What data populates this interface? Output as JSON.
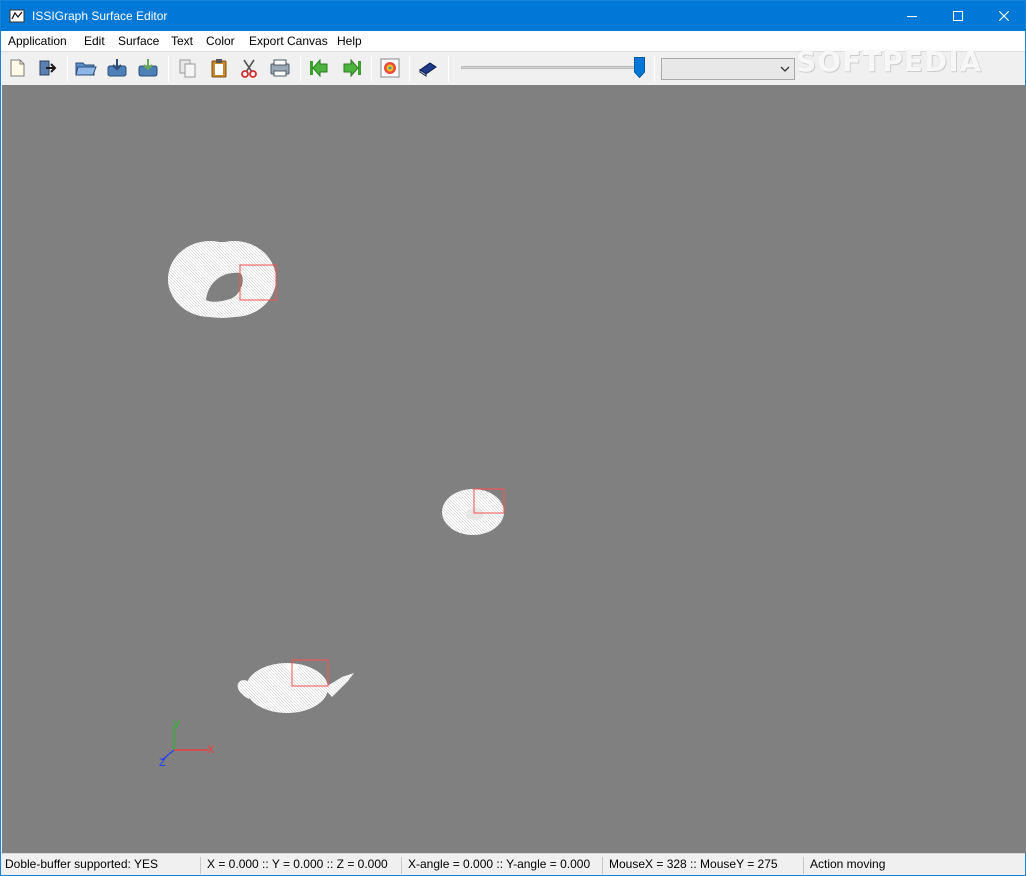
{
  "window": {
    "title": "ISSIGraph Surface Editor",
    "accent_color": "#0078d7"
  },
  "menu": [
    {
      "label": "Application"
    },
    {
      "label": "Edit"
    },
    {
      "label": "Surface"
    },
    {
      "label": "Text"
    },
    {
      "label": "Color"
    },
    {
      "label": "Export Canvas"
    },
    {
      "label": "Help"
    }
  ],
  "toolbar": {
    "buttons": [
      {
        "icon": "new-document-icon"
      },
      {
        "icon": "exit-icon"
      },
      {
        "icon": "open-folder-icon"
      },
      {
        "icon": "save-icon"
      },
      {
        "icon": "save-as-icon"
      },
      {
        "icon": "copy-icon"
      },
      {
        "icon": "paste-icon"
      },
      {
        "icon": "cut-icon"
      },
      {
        "icon": "print-icon"
      },
      {
        "icon": "previous-icon"
      },
      {
        "icon": "next-icon"
      },
      {
        "icon": "color-palette-icon"
      },
      {
        "icon": "book-icon"
      }
    ],
    "slider_value": 1.0,
    "combo_value": ""
  },
  "watermark": "SOFTPEDIA",
  "canvas": {
    "background": "#808080",
    "objects": [
      "torus-object",
      "disc-object",
      "teapot-object"
    ],
    "axes": {
      "x": "X",
      "y": "Y",
      "z": "Z"
    }
  },
  "status": {
    "double_buffer": "Doble-buffer supported: YES",
    "xyz": "X = 0.000 :: Y = 0.000 :: Z = 0.000",
    "angles": "X-angle = 0.000 :: Y-angle = 0.000",
    "mouse": "MouseX = 328 :: MouseY = 275",
    "action": "Action moving"
  }
}
